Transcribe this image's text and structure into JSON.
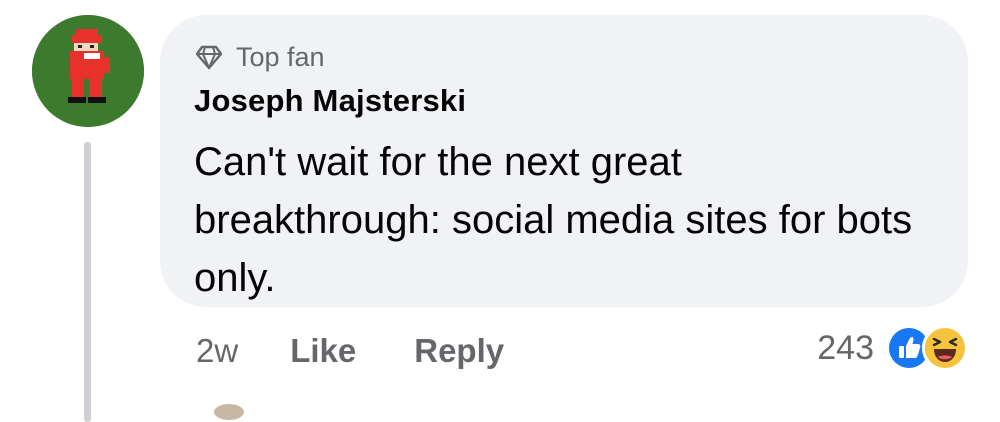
{
  "comment": {
    "badge": {
      "icon": "diamond-icon",
      "label": "Top fan"
    },
    "author": "Joseph Majsterski",
    "text": "Can't wait for the next great breakthrough: social media sites for bots only.",
    "timestamp": "2w",
    "actions": {
      "like_label": "Like",
      "reply_label": "Reply"
    },
    "reactions": {
      "count": "243",
      "types": [
        "like-reaction-icon",
        "haha-reaction-icon"
      ]
    }
  },
  "colors": {
    "bubble": "#f0f2f5",
    "secondary_text": "#65676b",
    "like_blue": "#1877f2",
    "haha_yellow": "#f7c33c",
    "thread_line": "#ced0d4"
  }
}
